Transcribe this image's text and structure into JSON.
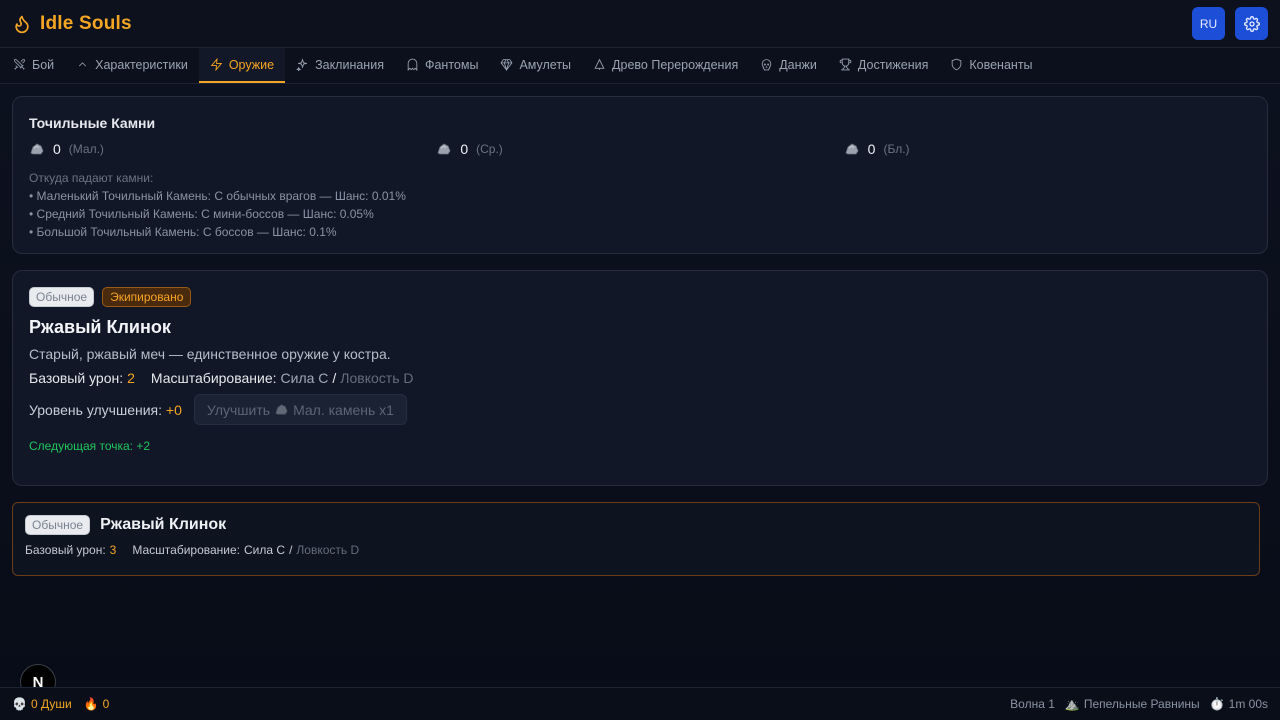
{
  "app": {
    "title": "Idle Souls"
  },
  "header": {
    "lang_label": "RU"
  },
  "tabs": [
    {
      "label": "Бой",
      "icon": "swords-icon"
    },
    {
      "label": "Характеристики",
      "icon": "chevron-up-icon"
    },
    {
      "label": "Оружие",
      "icon": "lightning-icon",
      "active": true
    },
    {
      "label": "Заклинания",
      "icon": "sparkles-icon"
    },
    {
      "label": "Фантомы",
      "icon": "ghost-icon"
    },
    {
      "label": "Амулеты",
      "icon": "gem-icon"
    },
    {
      "label": "Древо Перерождения",
      "icon": "tree-icon"
    },
    {
      "label": "Данжи",
      "icon": "skull-icon"
    },
    {
      "label": "Достижения",
      "icon": "trophy-icon"
    },
    {
      "label": "Ковенанты",
      "icon": "shield-icon"
    }
  ],
  "stones": {
    "title": "Точильные Камни",
    "items": [
      {
        "count": "0",
        "size": "(Мал.)"
      },
      {
        "count": "0",
        "size": "(Ср.)"
      },
      {
        "count": "0",
        "size": "(Бл.)"
      }
    ],
    "drops_title": "Откуда падают камни:",
    "drops": [
      "• Маленький Точильный Камень: С обычных врагов — Шанс: 0.01%",
      "• Средний Точильный Камень: С мини-боссов — Шанс: 0.05%",
      "• Большой Точильный Камень: С боссов — Шанс: 0.1%"
    ]
  },
  "weapon": {
    "rarity": "Обычное",
    "equipped": "Экипировано",
    "name": "Ржавый Клинок",
    "description": "Старый, ржавый меч — единственное оружие у костра.",
    "base_damage_label": "Базовый урон:",
    "base_damage": "2",
    "scaling_label": "Масштабирование:",
    "scaling_str": "Сила C",
    "scaling_sep": "/",
    "scaling_dex": "Ловкость D",
    "upgrade_label": "Уровень улучшения:",
    "upgrade_level": "+0",
    "upgrade_button_prefix": "Улучшить",
    "upgrade_button_suffix": "Мал. камень x1",
    "next_point": "Следующая точка: +2"
  },
  "inventory": [
    {
      "rarity": "Обычное",
      "name": "Ржавый Клинок",
      "base_damage_label": "Базовый урон:",
      "base_damage": "3",
      "scaling_label": "Масштабирование:",
      "scaling_str": "Сила C",
      "scaling_sep": "/",
      "scaling_dex": "Ловкость D"
    }
  ],
  "fab": {
    "label": "N"
  },
  "footer": {
    "souls": "0 Души",
    "embers": "0",
    "wave": "Волна 1",
    "location": "Пепельные Равнины",
    "timer": "1m 00s"
  },
  "colors": {
    "accent": "#f5a524",
    "primary": "#1d4ed8",
    "success": "#22c55e"
  }
}
